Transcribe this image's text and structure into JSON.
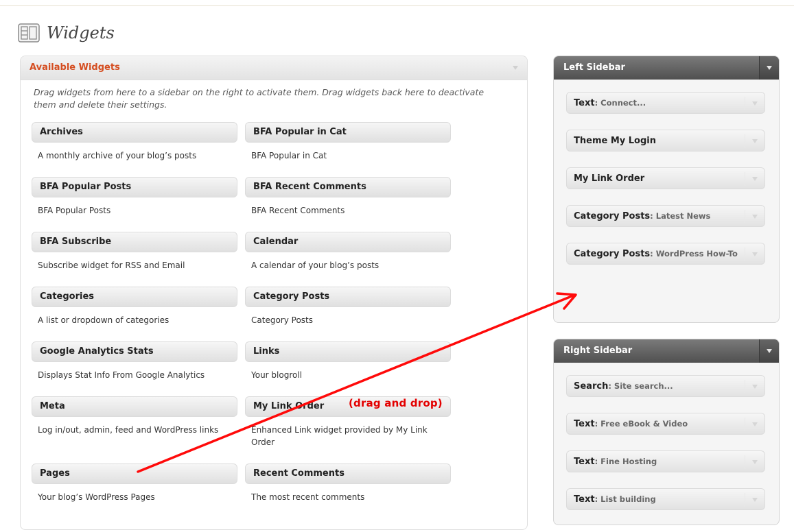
{
  "page": {
    "title": "Widgets"
  },
  "available": {
    "title": "Available Widgets",
    "description": "Drag widgets from here to a sidebar on the right to activate them. Drag widgets back here to deactivate them and delete their settings.",
    "widgets": [
      {
        "name": "Archives",
        "desc": "A monthly archive of your blog’s posts"
      },
      {
        "name": "BFA Popular in Cat",
        "desc": "BFA Popular in Cat"
      },
      {
        "name": "BFA Popular Posts",
        "desc": "BFA Popular Posts"
      },
      {
        "name": "BFA Recent Comments",
        "desc": "BFA Recent Comments"
      },
      {
        "name": "BFA Subscribe",
        "desc": "Subscribe widget for RSS and Email"
      },
      {
        "name": "Calendar",
        "desc": "A calendar of your blog’s posts"
      },
      {
        "name": "Categories",
        "desc": "A list or dropdown of categories"
      },
      {
        "name": "Category Posts",
        "desc": "Category Posts"
      },
      {
        "name": "Google Analytics Stats",
        "desc": "Displays Stat Info From Google Analytics"
      },
      {
        "name": "Links",
        "desc": "Your blogroll"
      },
      {
        "name": "Meta",
        "desc": "Log in/out, admin, feed and WordPress links"
      },
      {
        "name": "My Link Order",
        "desc": "Enhanced Link widget provided by My Link Order"
      },
      {
        "name": "Pages",
        "desc": "Your blog’s WordPress Pages"
      },
      {
        "name": "Recent Comments",
        "desc": "The most recent comments"
      }
    ]
  },
  "left_sidebar": {
    "title": "Left Sidebar",
    "widgets": [
      {
        "name": "Text",
        "sub": ": Connect..."
      },
      {
        "name": "Theme My Login",
        "sub": ""
      },
      {
        "name": "My Link Order",
        "sub": ""
      },
      {
        "name": "Category Posts",
        "sub": ": Latest News"
      },
      {
        "name": "Category Posts",
        "sub": ": WordPress How-To"
      }
    ]
  },
  "right_sidebar": {
    "title": "Right Sidebar",
    "widgets": [
      {
        "name": "Search",
        "sub": ": Site search..."
      },
      {
        "name": "Text",
        "sub": ": Free eBook & Video"
      },
      {
        "name": "Text",
        "sub": ": Fine Hosting"
      },
      {
        "name": "Text",
        "sub": ": List building"
      }
    ]
  },
  "annotation": {
    "text": "(drag and drop)",
    "color": "#e30000"
  },
  "colors": {
    "accent": "#d54e21",
    "sidebar_head": "#5a5a5a"
  }
}
